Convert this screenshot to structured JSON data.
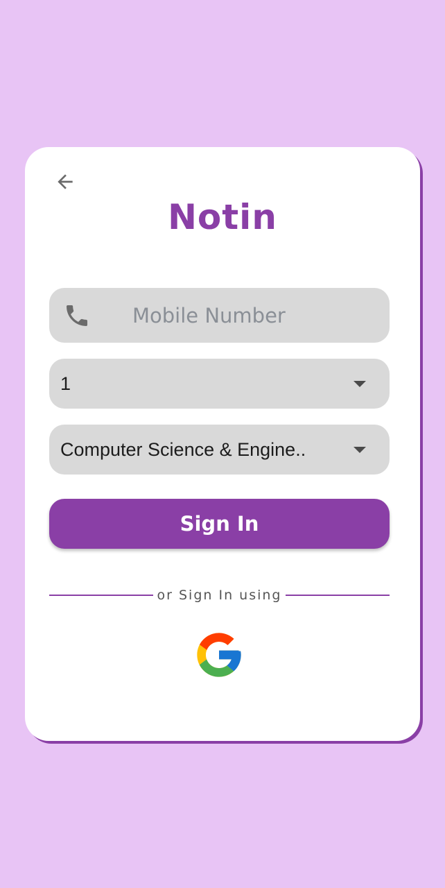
{
  "app": {
    "title": "Notin"
  },
  "form": {
    "mobile_placeholder": "Mobile Number",
    "mobile_value": "",
    "semester_value": "1",
    "branch_value": "Computer Science & Engine..",
    "signin_label": "Sign In",
    "alt_signin_text": "or Sign In using"
  },
  "icons": {
    "back": "arrow-left-icon",
    "phone": "phone-icon",
    "dropdown": "chevron-down-icon",
    "google": "google-icon"
  },
  "colors": {
    "background": "#e8c4f5",
    "accent": "#8a3fa6",
    "field": "#d9d9d9"
  }
}
